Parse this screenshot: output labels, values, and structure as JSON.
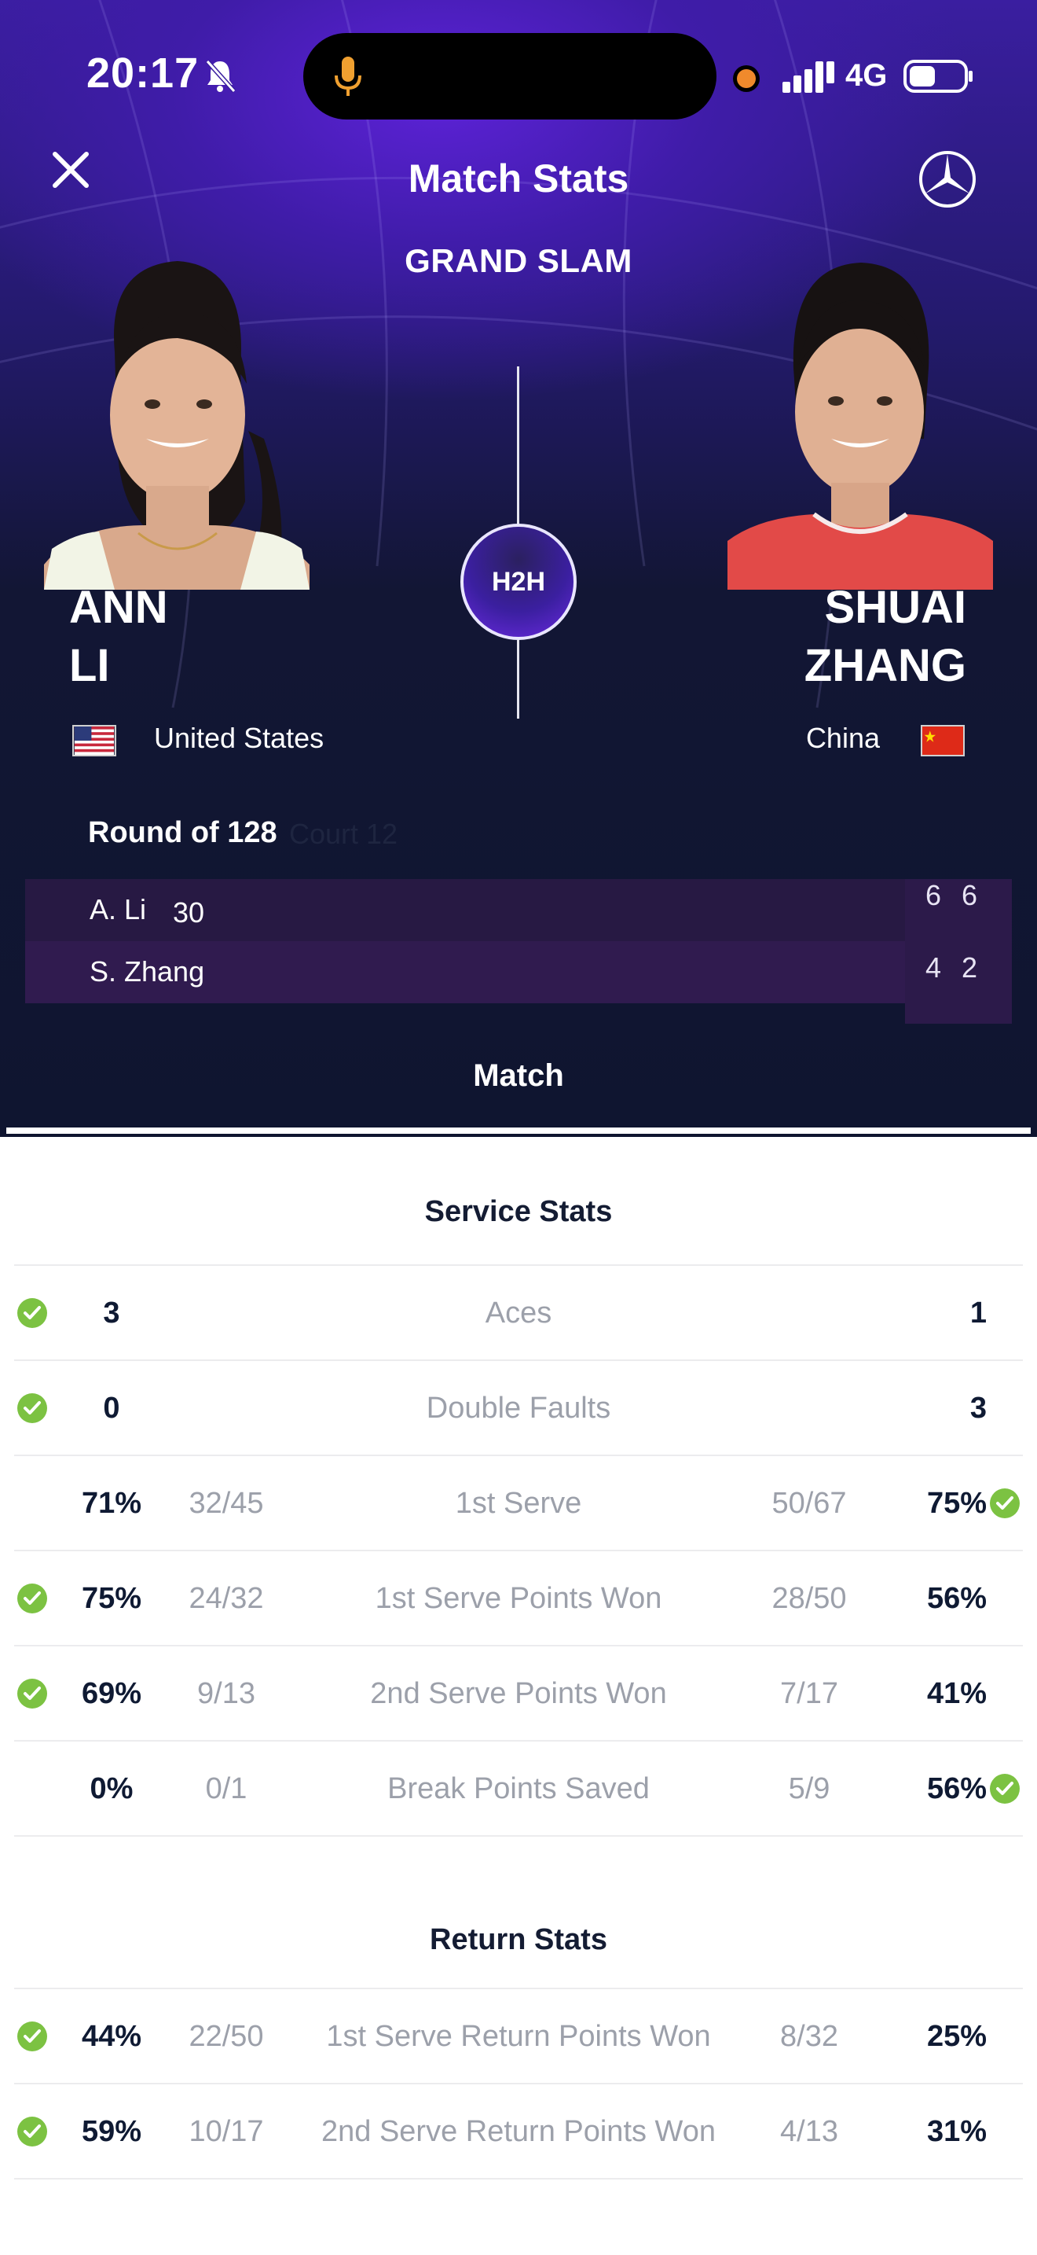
{
  "status": {
    "time": "20:17",
    "network": "4G"
  },
  "header": {
    "title": "Match Stats",
    "subtitle": "GRAND SLAM",
    "h2h_label": "H2H"
  },
  "players": {
    "left": {
      "first": "ANN",
      "last": "LI",
      "country": "United States",
      "short": "A. Li"
    },
    "right": {
      "first": "SHUAI",
      "last": "ZHANG",
      "country": "China",
      "short": "S. Zhang"
    }
  },
  "match": {
    "round": "Round of 128",
    "court": "Court 12",
    "current_game_left": "30",
    "sets_left": [
      "6",
      "6"
    ],
    "sets_right": [
      "4",
      "2"
    ]
  },
  "tab": {
    "label": "Match"
  },
  "service_stats": {
    "title": "Service Stats",
    "rows": [
      {
        "label": "Aces",
        "left_value": "3",
        "left_fraction": "",
        "right_fraction": "",
        "right_value": "1",
        "winner": "left"
      },
      {
        "label": "Double Faults",
        "left_value": "0",
        "left_fraction": "",
        "right_fraction": "",
        "right_value": "3",
        "winner": "left"
      },
      {
        "label": "1st Serve",
        "left_value": "71%",
        "left_fraction": "32/45",
        "right_fraction": "50/67",
        "right_value": "75%",
        "winner": "right"
      },
      {
        "label": "1st Serve Points Won",
        "left_value": "75%",
        "left_fraction": "24/32",
        "right_fraction": "28/50",
        "right_value": "56%",
        "winner": "left"
      },
      {
        "label": "2nd Serve Points Won",
        "left_value": "69%",
        "left_fraction": "9/13",
        "right_fraction": "7/17",
        "right_value": "41%",
        "winner": "left"
      },
      {
        "label": "Break Points Saved",
        "left_value": "0%",
        "left_fraction": "0/1",
        "right_fraction": "5/9",
        "right_value": "56%",
        "winner": "right"
      }
    ]
  },
  "return_stats": {
    "title": "Return Stats",
    "rows": [
      {
        "label": "1st Serve Return Points Won",
        "left_value": "44%",
        "left_fraction": "22/50",
        "right_fraction": "8/32",
        "right_value": "25%",
        "winner": "left"
      },
      {
        "label": "2nd Serve Return Points Won",
        "left_value": "59%",
        "left_fraction": "10/17",
        "right_fraction": "4/13",
        "right_value": "31%",
        "winner": "left"
      }
    ]
  },
  "colors": {
    "accent_green": "#7cc242",
    "hero_purple": "#4a1fc0",
    "navy": "#0f1530"
  },
  "icons": [
    "bell-slash-icon",
    "mic-icon",
    "signal-icon",
    "battery-icon",
    "close-icon",
    "brand-star-icon",
    "us-flag-icon",
    "china-flag-icon",
    "check-circle-icon"
  ]
}
